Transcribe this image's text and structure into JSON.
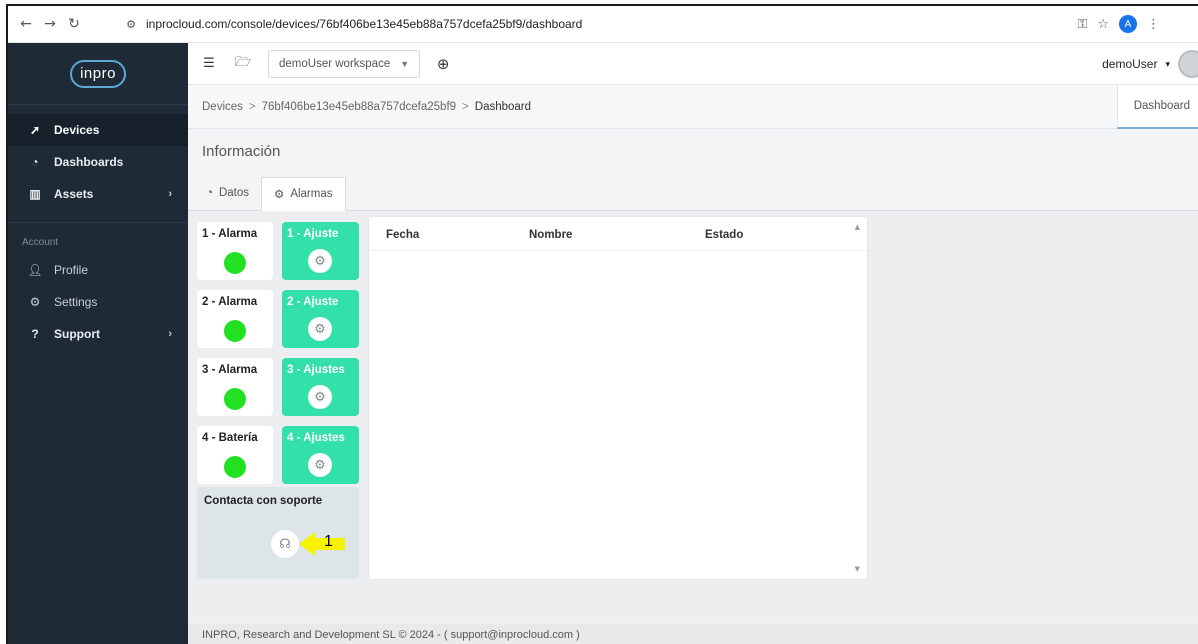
{
  "browser": {
    "url": "inprocloud.com/console/devices/76bf406be13e45eb88a757dcefa25bf9/dashboard",
    "profile_initial": "A",
    "icons": [
      "back-icon",
      "forward-icon",
      "reload-icon",
      "site-info-icon",
      "key-icon",
      "star-icon",
      "menu-dots-icon"
    ]
  },
  "sidebar": {
    "logo_text": "inpro",
    "items": [
      {
        "label": "Devices",
        "icon": "rocket-icon",
        "active": true
      },
      {
        "label": "Dashboards",
        "icon": "dashboard-icon",
        "active": false
      },
      {
        "label": "Assets",
        "icon": "building-icon",
        "active": false,
        "chevron": "›"
      }
    ],
    "account_label": "Account",
    "account_items": [
      {
        "label": "Profile",
        "icon": "user-icon"
      },
      {
        "label": "Settings",
        "icon": "cogs-icon"
      },
      {
        "label": "Support",
        "icon": "question-icon",
        "chevron": "›"
      }
    ]
  },
  "topbar": {
    "workspace": "demoUser workspace",
    "user": "demoUser"
  },
  "breadcrumb": {
    "items": [
      "Devices",
      "76bf406be13e45eb88a757dcefa25bf9",
      "Dashboard"
    ],
    "separator": ">",
    "right_tab": "Dashboard"
  },
  "section_title": "Información",
  "tabs": [
    {
      "label": "Datos",
      "active": false
    },
    {
      "label": "Alarmas",
      "active": true
    }
  ],
  "cards": [
    {
      "alarm": "1 - Alarma",
      "ajuste": "1 - Ajuste"
    },
    {
      "alarm": "2 - Alarma",
      "ajuste": "2 - Ajuste"
    },
    {
      "alarm": "3 - Alarma",
      "ajuste": "3 - Ajustes"
    },
    {
      "alarm": "4 - Batería",
      "ajuste": "4 - Ajustes"
    }
  ],
  "status_color": "#22e022",
  "accent_color": "#34e0a9",
  "support": {
    "label": "Contacta con soporte",
    "annotation_number": "1"
  },
  "table": {
    "columns": [
      "Fecha",
      "Nombre",
      "Estado"
    ]
  },
  "footer": "INPRO, Research and Development SL © 2024 - ( support@inprocloud.com )"
}
